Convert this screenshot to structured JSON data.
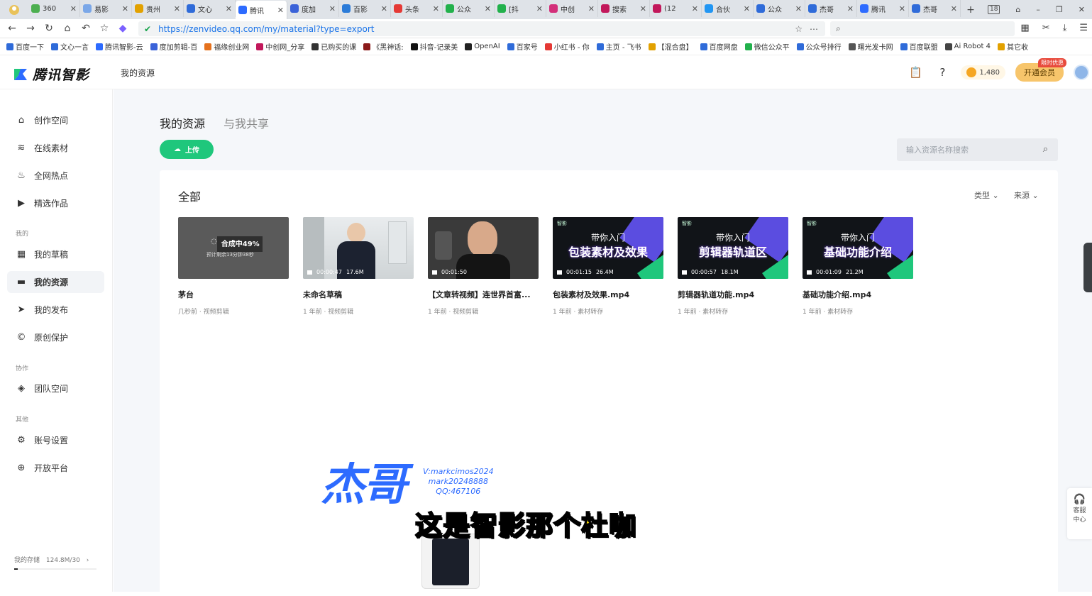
{
  "browser": {
    "tabs": [
      {
        "title": "360",
        "color": "#4caf50"
      },
      {
        "title": "易影",
        "color": "#7aa7e8"
      },
      {
        "title": "贵州",
        "color": "#e2a100"
      },
      {
        "title": "文心",
        "color": "#2f6bd9"
      },
      {
        "title": "腾讯",
        "color": "#2d6bff",
        "active": true
      },
      {
        "title": "度加",
        "color": "#3a62d8"
      },
      {
        "title": "百影",
        "color": "#2b7bd8"
      },
      {
        "title": "头条",
        "color": "#e53935"
      },
      {
        "title": "公众",
        "color": "#22b14c"
      },
      {
        "title": "[抖",
        "color": "#22b14c"
      },
      {
        "title": "中创",
        "color": "#d32f7a"
      },
      {
        "title": "搜索",
        "color": "#c2185b"
      },
      {
        "title": "(12",
        "color": "#c2185b"
      },
      {
        "title": "合伙",
        "color": "#2196f3"
      },
      {
        "title": "公众",
        "color": "#2f6bd9"
      },
      {
        "title": "杰哥",
        "color": "#2f6bd9"
      },
      {
        "title": "腾讯",
        "color": "#2d6bff"
      },
      {
        "title": "杰哥",
        "color": "#2f6bd9"
      }
    ],
    "tab_count": "18",
    "url": "https://zenvideo.qq.com/my/material?type=export",
    "bookmarks": [
      {
        "label": "百度一下",
        "color": "#2f6bd9"
      },
      {
        "label": "文心一言",
        "color": "#2f6bd9"
      },
      {
        "label": "腾讯智影-云",
        "color": "#2d6bff"
      },
      {
        "label": "度加剪辑-百",
        "color": "#3a62d8"
      },
      {
        "label": "福缘创业网",
        "color": "#e5711d"
      },
      {
        "label": "中创网_分享",
        "color": "#c2185b"
      },
      {
        "label": "已购买的课",
        "color": "#333333"
      },
      {
        "label": "《黑神话:",
        "color": "#8b1a1a"
      },
      {
        "label": "抖音-记录美",
        "color": "#111111"
      },
      {
        "label": "OpenAI",
        "color": "#222222"
      },
      {
        "label": "百家号",
        "color": "#2f6bd9"
      },
      {
        "label": "小红书 - 你",
        "color": "#e53935"
      },
      {
        "label": "主页 - 飞书",
        "color": "#2f6bd9"
      },
      {
        "label": "【混合盘】",
        "color": "#e2a100"
      },
      {
        "label": "百度网盘",
        "color": "#2f6bd9"
      },
      {
        "label": "微信公众平",
        "color": "#22b14c"
      },
      {
        "label": "公众号排行",
        "color": "#2f6bd9"
      },
      {
        "label": "曙光发卡网",
        "color": "#555555"
      },
      {
        "label": "百度联盟",
        "color": "#2f6bd9"
      },
      {
        "label": "Ai Robot 4",
        "color": "#444444"
      },
      {
        "label": "其它收",
        "color": "#e2a100"
      }
    ]
  },
  "app": {
    "logo_text": "腾讯智影",
    "header_title": "我的资源",
    "coin_count": "1,480",
    "vip_label": "开通会员",
    "vip_tag": "限时优惠"
  },
  "sidebar": {
    "items": [
      {
        "label": "创作空间",
        "icon": "⌂"
      },
      {
        "label": "在线素材",
        "icon": "≋"
      },
      {
        "label": "全网热点",
        "icon": "♨"
      },
      {
        "label": "精选作品",
        "icon": "▶"
      },
      {
        "label": "我的草稿",
        "icon": "▦"
      },
      {
        "label": "我的资源",
        "icon": "▬",
        "active": true
      },
      {
        "label": "我的发布",
        "icon": "➤"
      },
      {
        "label": "原创保护",
        "icon": "©"
      },
      {
        "label": "团队空间",
        "icon": "◈"
      },
      {
        "label": "账号设置",
        "icon": "⚙"
      },
      {
        "label": "开放平台",
        "icon": "⊕"
      }
    ],
    "groups": [
      "我的",
      "协作",
      "其他"
    ],
    "storage_label": "我的存储",
    "storage_value": "124.8M/30",
    "storage_fraction": 0.04
  },
  "main": {
    "tab_mine": "我的资源",
    "tab_shared": "与我共享",
    "upload_label": "上传",
    "search_placeholder": "输入资源名称搜索",
    "panel_title": "全部",
    "filter_type": "类型",
    "filter_source": "来源",
    "cards": [
      {
        "name": "茅台",
        "meta": "几秒前 · 视频剪辑",
        "kind": "progress",
        "progress_text": "合成中49%",
        "progress_sub": "预计剩余13分钟38秒"
      },
      {
        "name": "未命名草稿",
        "meta": "1 年前 · 视频剪辑",
        "kind": "photo-man",
        "duration": "00:00:47",
        "size": "17.6M"
      },
      {
        "name": "【文章转视频】连世界首富...",
        "meta": "1 年前 · 视频剪辑",
        "kind": "photo-musk",
        "duration": "00:01:50",
        "size": ""
      },
      {
        "name": "包装素材及效果.mp4",
        "meta": "1 年前 · 素材转存",
        "kind": "banner",
        "banner_l1": "带你入门",
        "banner_l2": "包装素材及效果",
        "brand": "智影",
        "duration": "00:01:15",
        "size": "26.4M"
      },
      {
        "name": "剪辑器轨道功能.mp4",
        "meta": "1 年前 · 素材转存",
        "kind": "banner",
        "banner_l1": "带你入门",
        "banner_l2": "剪辑器轨道区",
        "brand": "智影",
        "duration": "00:00:57",
        "size": "18.1M"
      },
      {
        "name": "基础功能介绍.mp4",
        "meta": "1 年前 · 素材转存",
        "kind": "banner",
        "banner_l1": "带你入门",
        "banner_l2": "基础功能介绍",
        "brand": "智影",
        "duration": "00:01:09",
        "size": "21.2M"
      }
    ]
  },
  "overlay": {
    "watermark_big": "杰哥",
    "contact_lines": [
      "V:markcimos2024",
      "mark20248888",
      "QQ:467106"
    ],
    "subtitle": "这是智影那个杜咖",
    "help_label_1": "客服",
    "help_label_2": "中心"
  }
}
